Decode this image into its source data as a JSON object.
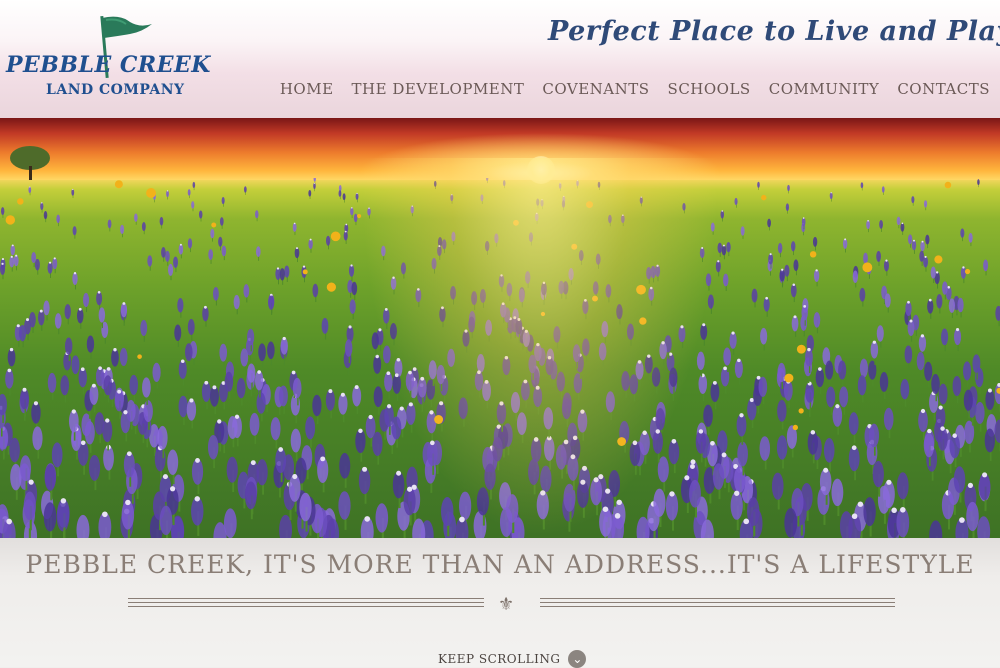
{
  "logo": {
    "line1": "PEBBLE CREEK",
    "line2": "LAND COMPANY",
    "icon": "flag-icon",
    "colors": {
      "brand_blue": "#1f4f8f",
      "flag_green": "#2a7a5a"
    }
  },
  "header": {
    "tagline": "Perfect Place to Live and Play!"
  },
  "nav": {
    "items": [
      {
        "label": "HOME"
      },
      {
        "label": "THE DEVELOPMENT"
      },
      {
        "label": "COVENANTS"
      },
      {
        "label": "SCHOOLS"
      },
      {
        "label": "COMMUNITY"
      },
      {
        "label": "CONTACTS"
      }
    ]
  },
  "hero": {
    "icon": "bluebonnet-field-sunset-image"
  },
  "section": {
    "slogan": "PEBBLE CREEK, IT'S MORE THAN AN ADDRESS...IT'S A LIFESTYLE",
    "divider_icon": "fleur-de-lis-icon",
    "keep_scrolling": "KEEP SCROLLING",
    "keep_scrolling_icon": "chevron-down-circle-icon"
  }
}
